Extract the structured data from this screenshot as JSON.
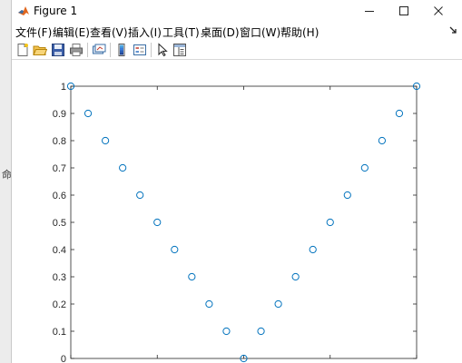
{
  "background_hint": {
    "command_glyph": "命"
  },
  "window": {
    "title": "Figure 1",
    "controls": {
      "minimize": "minimize",
      "maximize": "maximize",
      "close": "close"
    }
  },
  "menu": {
    "items": [
      {
        "label": "文件(F)"
      },
      {
        "label": "编辑(E)"
      },
      {
        "label": "查看(V)"
      },
      {
        "label": "插入(I)"
      },
      {
        "label": "工具(T)"
      },
      {
        "label": "桌面(D)"
      },
      {
        "label": "窗口(W)"
      },
      {
        "label": "帮助(H)"
      }
    ]
  },
  "toolbar": {
    "buttons": [
      {
        "icon": "new-figure-icon"
      },
      {
        "icon": "open-file-icon"
      },
      {
        "icon": "save-icon"
      },
      {
        "icon": "print-icon"
      },
      {
        "icon": "link-plot-icon"
      },
      {
        "icon": "insert-colorbar-icon"
      },
      {
        "icon": "insert-legend-icon"
      },
      {
        "icon": "edit-plot-arrow-icon"
      },
      {
        "icon": "open-property-inspector-icon"
      }
    ]
  },
  "chart_data": {
    "type": "scatter",
    "marker": "open-circle",
    "color": "#0072bd",
    "x": [
      -10,
      -9,
      -8,
      -7,
      -6,
      -5,
      -4,
      -3,
      -2,
      -1,
      0,
      1,
      2,
      3,
      4,
      5,
      6,
      7,
      8,
      9,
      10
    ],
    "y": [
      1,
      0.9,
      0.8,
      0.7,
      0.6,
      0.5,
      0.4,
      0.3,
      0.2,
      0.1,
      0,
      0.1,
      0.2,
      0.3,
      0.4,
      0.5,
      0.6,
      0.7,
      0.8,
      0.9,
      1
    ],
    "xlim": [
      -10,
      10
    ],
    "ylim": [
      0,
      1
    ],
    "yticks": [
      "0",
      "0.1",
      "0.2",
      "0.3",
      "0.4",
      "0.5",
      "0.6",
      "0.7",
      "0.8",
      "0.9",
      "1"
    ],
    "grid": false,
    "title": "",
    "xlabel": "",
    "ylabel": ""
  }
}
